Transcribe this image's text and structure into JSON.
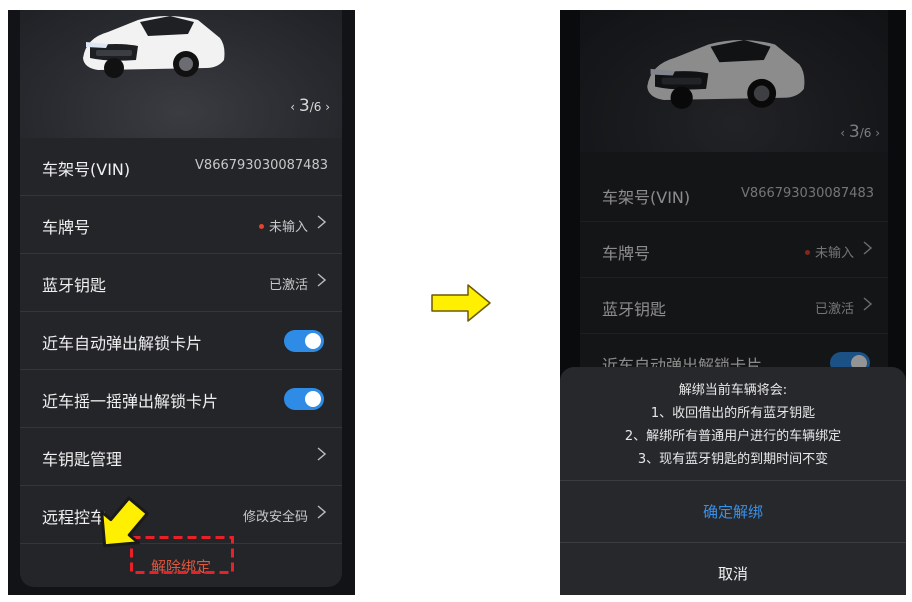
{
  "left": {
    "pager": {
      "current": "3",
      "total": "/6"
    },
    "rows": [
      {
        "label": "车架号(VIN)",
        "value": "V866793030087483"
      },
      {
        "label": "车牌号",
        "value": "未输入"
      },
      {
        "label": "蓝牙钥匙",
        "value": "已激活"
      },
      {
        "label": "近车自动弹出解锁卡片",
        "toggle_on": true
      },
      {
        "label": "近车摇一摇弹出解锁卡片",
        "toggle_on": true
      },
      {
        "label": "车钥匙管理",
        "value": ""
      },
      {
        "label": "远程控车",
        "value": "修改安全码"
      }
    ],
    "unbind_label": "解除绑定"
  },
  "right": {
    "pager": {
      "current": "3",
      "total": "/6"
    },
    "rows": [
      {
        "label": "车架号(VIN)",
        "value": "V866793030087483"
      },
      {
        "label": "车牌号",
        "value": "未输入"
      },
      {
        "label": "蓝牙钥匙",
        "value": "已激活"
      },
      {
        "label": "近车自动弹出解锁卡片",
        "toggle_on": true
      }
    ],
    "sheet": {
      "lines": [
        "解绑当前车辆将会:",
        "1、收回借出的所有蓝牙钥匙",
        "2、解绑所有普通用户进行的车辆绑定",
        "3、现有蓝牙钥匙的到期时间不变"
      ],
      "confirm": "确定解绑",
      "cancel": "取消"
    }
  },
  "colors": {
    "accent": "#2f8ce6",
    "danger": "#e2563e",
    "highlight": "#ffef00",
    "callout": "#e8202a"
  }
}
